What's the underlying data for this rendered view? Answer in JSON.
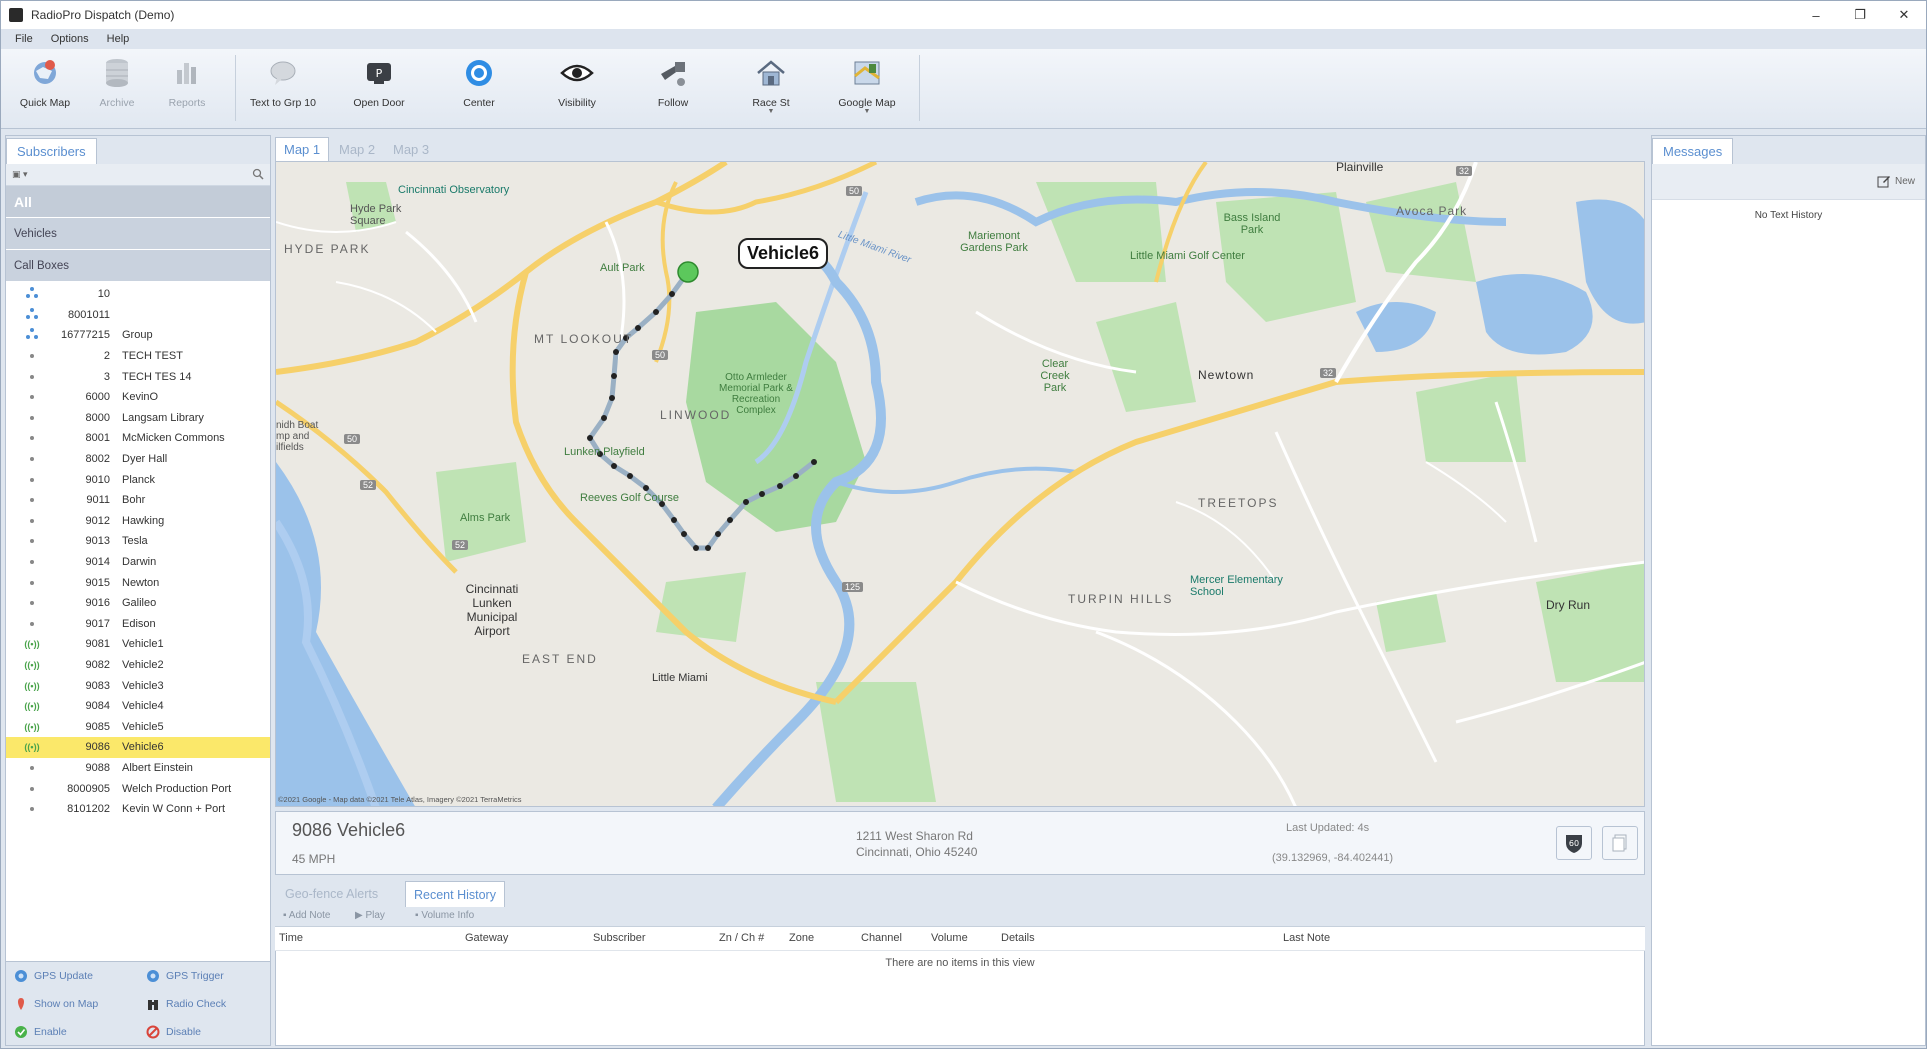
{
  "window": {
    "title": "RadioPro Dispatch (Demo)",
    "controls": [
      "–",
      "❐",
      "✕"
    ]
  },
  "menu": [
    "File",
    "Options",
    "Help"
  ],
  "ribbon": [
    {
      "label": "Quick Map",
      "icon": "quick-map-icon",
      "disabled": false
    },
    {
      "label": "Archive",
      "icon": "archive-icon",
      "disabled": true
    },
    {
      "label": "Reports",
      "icon": "reports-icon",
      "disabled": true
    },
    {
      "label": "Text to Grp 10",
      "icon": "text-bubble-icon",
      "disabled": false
    },
    {
      "label": "Open Door",
      "icon": "open-door-icon",
      "disabled": false
    },
    {
      "label": "Center",
      "icon": "center-target-icon",
      "disabled": false
    },
    {
      "label": "Visibility",
      "icon": "eye-icon",
      "disabled": false
    },
    {
      "label": "Follow",
      "icon": "follow-icon",
      "disabled": false
    },
    {
      "label": "Race St",
      "icon": "home-icon",
      "disabled": false
    },
    {
      "label": "Google Map",
      "icon": "google-map-icon",
      "disabled": false
    }
  ],
  "left": {
    "tab": "Subscribers",
    "groups": [
      "All",
      "Vehicles",
      "Call Boxes"
    ],
    "rows": [
      {
        "id": "10",
        "name": "",
        "icon": "group"
      },
      {
        "id": "8001011",
        "name": "",
        "icon": "group"
      },
      {
        "id": "16777215",
        "name": "Group",
        "icon": "group"
      },
      {
        "id": "2",
        "name": "TECH TEST",
        "icon": "dot"
      },
      {
        "id": "3",
        "name": "TECH TES 14",
        "icon": "dot"
      },
      {
        "id": "6000",
        "name": "KevinO",
        "icon": "dot"
      },
      {
        "id": "8000",
        "name": "Langsam Library",
        "icon": "dot"
      },
      {
        "id": "8001",
        "name": "McMicken Commons",
        "icon": "dot"
      },
      {
        "id": "8002",
        "name": "Dyer Hall",
        "icon": "dot"
      },
      {
        "id": "9010",
        "name": "Planck",
        "icon": "dot"
      },
      {
        "id": "9011",
        "name": "Bohr",
        "icon": "dot"
      },
      {
        "id": "9012",
        "name": "Hawking",
        "icon": "dot"
      },
      {
        "id": "9013",
        "name": "Tesla",
        "icon": "dot"
      },
      {
        "id": "9014",
        "name": "Darwin",
        "icon": "dot"
      },
      {
        "id": "9015",
        "name": "Newton",
        "icon": "dot"
      },
      {
        "id": "9016",
        "name": "Galileo",
        "icon": "dot"
      },
      {
        "id": "9017",
        "name": "Edison",
        "icon": "dot"
      },
      {
        "id": "9081",
        "name": "Vehicle1",
        "icon": "radio"
      },
      {
        "id": "9082",
        "name": "Vehicle2",
        "icon": "radio"
      },
      {
        "id": "9083",
        "name": "Vehicle3",
        "icon": "radio"
      },
      {
        "id": "9084",
        "name": "Vehicle4",
        "icon": "radio"
      },
      {
        "id": "9085",
        "name": "Vehicle5",
        "icon": "radio"
      },
      {
        "id": "9086",
        "name": "Vehicle6",
        "icon": "radio",
        "selected": true
      },
      {
        "id": "9088",
        "name": "Albert Einstein",
        "icon": "dot"
      },
      {
        "id": "8000905",
        "name": "Welch Production Port",
        "icon": "dot"
      },
      {
        "id": "8101202",
        "name": "Kevin W Conn + Port",
        "icon": "dot"
      }
    ],
    "actions": {
      "gps_update": "GPS Update",
      "gps_trigger": "GPS Trigger",
      "show_on_map": "Show on Map",
      "radio_check": "Radio Check",
      "enable": "Enable",
      "disable": "Disable"
    }
  },
  "map": {
    "tabs": [
      "Map 1",
      "Map 2",
      "Map 3"
    ],
    "vehicle_label": "Vehicle6",
    "labels": {
      "plainville": "Plainville",
      "cincinnati_observatory": "Cincinnati Observatory",
      "hyde_park_square": "Hyde Park Square",
      "hyde_park": "HYDE PARK",
      "mariemont_gardens": "Mariemont Gardens Park",
      "bass_island": "Bass Island Park",
      "avoca_park": "Avoca Park",
      "ault_park": "Ault Park",
      "little_miami_golf": "Little Miami Golf Center",
      "mt_lookout": "MT LOOKOUT",
      "clear_creek": "Clear Creek Park",
      "newtown": "Newtown",
      "otto_armleder": "Otto Armleder Memorial Park & Recreation Complex",
      "linwood": "LINWOOD",
      "lunken_playfield": "Lunken Playfield",
      "reeves_golf": "Reeves Golf Course",
      "treetops": "TREETOPS",
      "alms_park": "Alms Park",
      "airport": "Cincinnati Lunken Municipal Airport",
      "mercer_school": "Mercer Elementary School",
      "turpin_hills": "TURPIN HILLS",
      "dry_run": "Dry Run",
      "east_end": "EAST END",
      "little_miami": "Little Miami",
      "boat_ramp": "nidh Boat mp and ilfields",
      "little_miami_river": "Little Miami River"
    },
    "road_shields": [
      "50",
      "50",
      "50",
      "52",
      "52",
      "125",
      "32",
      "32"
    ],
    "attribution": "©2021 Google - Map data ©2021 Tele Atlas, Imagery ©2021 TerraMetrics"
  },
  "info": {
    "title": "9086 Vehicle6",
    "speed": "45 MPH",
    "address_line1": "1211 West Sharon Rd",
    "address_line2": "Cincinnati, Ohio 45240",
    "last_updated": "Last Updated: 4s",
    "coords": "(39.132969, -84.402441)"
  },
  "history": {
    "tabs": [
      "Geo-fence Alerts",
      "Recent History"
    ],
    "toolbar": [
      "Add Note",
      "Play",
      "Volume Info"
    ],
    "columns": [
      "Time",
      "Gateway",
      "Subscriber",
      "Zn / Ch #",
      "Zone",
      "Channel",
      "Volume",
      "Details",
      "Last Note"
    ],
    "empty": "There are no items in this view"
  },
  "messages": {
    "tab": "Messages",
    "new": "New",
    "empty": "No Text History"
  },
  "colors": {
    "accent": "#5b8fd0",
    "selected_row": "#fbe86a",
    "route": "#9ab0c4",
    "vehicle_marker": "#5cc85c"
  }
}
